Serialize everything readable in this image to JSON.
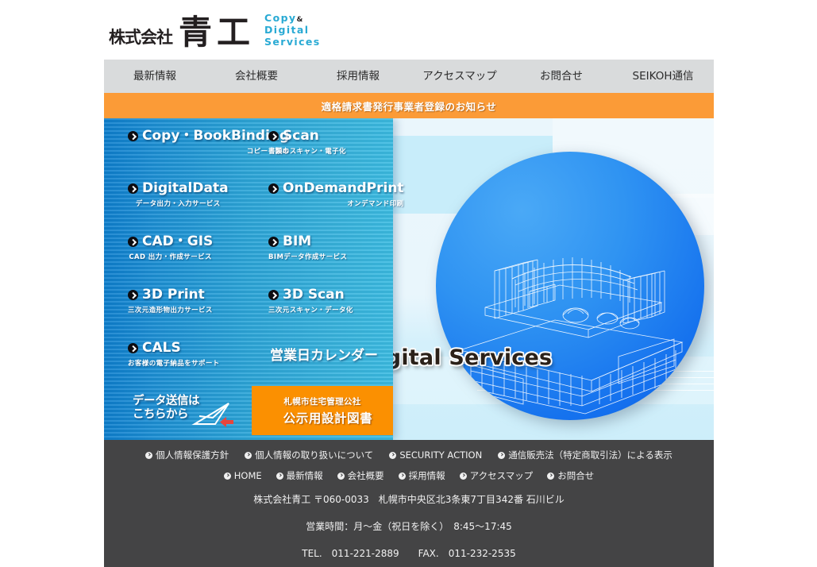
{
  "header": {
    "company_prefix": "株式会社",
    "company_name": "青工",
    "tagline_line1": "Copy",
    "tagline_amp": "&",
    "tagline_line2": "Digital",
    "tagline_line3": "Services"
  },
  "nav": {
    "items": [
      {
        "label": "最新情報"
      },
      {
        "label": "会社概要"
      },
      {
        "label": "採用情報"
      },
      {
        "label": "アクセスマップ"
      },
      {
        "label": "お問合せ"
      },
      {
        "label": "SEIKOH通信"
      }
    ]
  },
  "banner": {
    "text": "適格請求書発行事業者登録のお知らせ",
    "color": "#fb9b37"
  },
  "hero": {
    "title": "Copy & Digital Services",
    "circle_color": "#1470ee",
    "panel_color": "#2ba4d8"
  },
  "services": {
    "left": [
      {
        "en": "Copy・BookBinding",
        "jp": "コピー・製本"
      },
      {
        "en": "DigitalData",
        "jp": "データ出力・入力サービス"
      },
      {
        "en": "CAD・GIS",
        "jp": "CAD 出力・作成サービス"
      },
      {
        "en": "3D Print",
        "jp": "三次元造形物出力サービス"
      },
      {
        "en": "CALS",
        "jp": "お客様の電子納品をサポート"
      }
    ],
    "right": [
      {
        "en": "Scan",
        "jp": "書類のスキャン・電子化"
      },
      {
        "en": "OnDemandPrint",
        "jp": "オンデマンド印刷"
      },
      {
        "en": "BIM",
        "jp": "BIMデータ作成サービス"
      },
      {
        "en": "3D Scan",
        "jp": "三次元スキャン・データ化"
      }
    ],
    "calendar_label": "営業日カレンダー",
    "mail_button": {
      "line1": "データ送信は",
      "line2": "こちらから"
    },
    "orange_button": {
      "small": "札幌市住宅管理公社",
      "big": "公示用設計図書",
      "color": "#fb9001"
    }
  },
  "footer": {
    "background": "#444445",
    "links_row1": [
      {
        "label": "個人情報保護方針"
      },
      {
        "label": "個人情報の取り扱いについて"
      },
      {
        "label": "SECURITY ACTION"
      },
      {
        "label": "通信販売法（特定商取引法）による表示"
      }
    ],
    "links_row2": [
      {
        "label": "HOME"
      },
      {
        "label": "最新情報"
      },
      {
        "label": "会社概要"
      },
      {
        "label": "採用情報"
      },
      {
        "label": "アクセスマップ"
      },
      {
        "label": "お問合せ"
      }
    ],
    "address": "株式会社青工 〒060-0033　札幌市中央区北3条東7丁目342番 石川ビル",
    "hours": "営業時間：月～金（祝日を除く）　8:45～17:45",
    "contact": "TEL.　011-221-2889　　FAX.　011-232-2535"
  }
}
